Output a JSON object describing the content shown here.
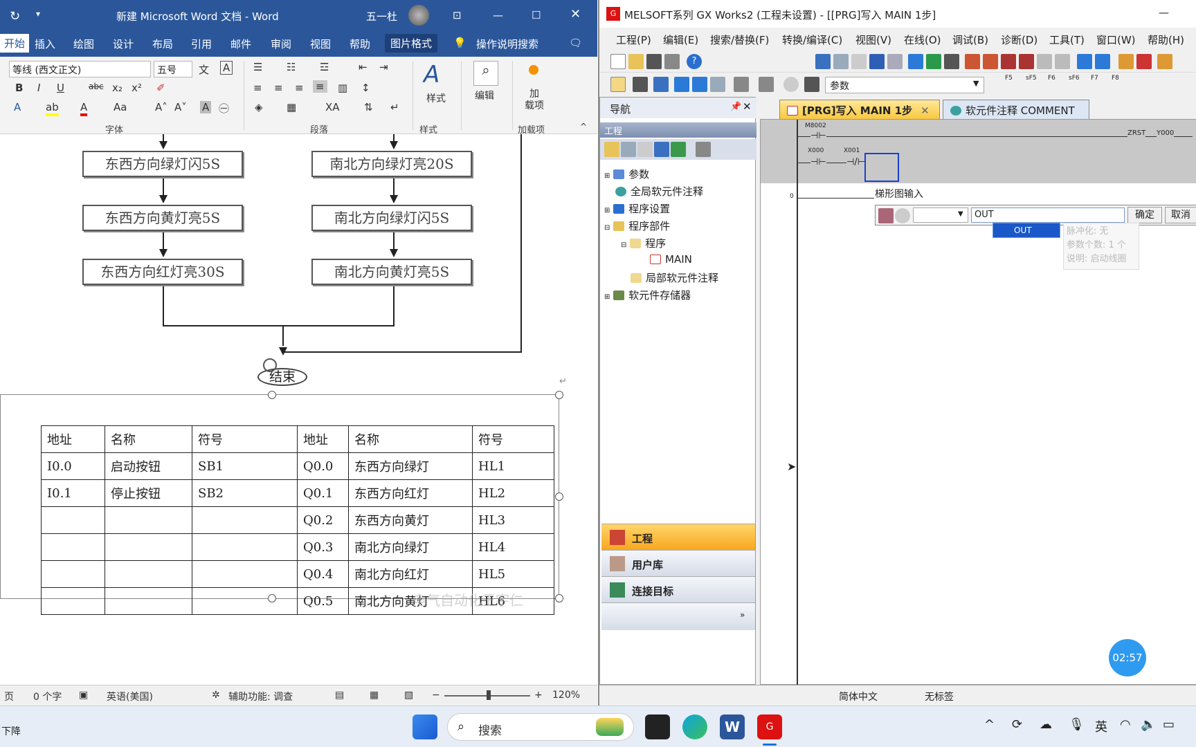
{
  "word": {
    "title": "新建 Microsoft Word 文档  -  Word",
    "user": "五一杜",
    "tabs": [
      "开始",
      "插入",
      "绘图",
      "设计",
      "布局",
      "引用",
      "邮件",
      "审阅",
      "视图",
      "帮助",
      "图片格式"
    ],
    "tell_me": "操作说明搜索",
    "font_name": "等线 (西文正文)",
    "font_size": "五号",
    "groups": {
      "font": "字体",
      "paragraph": "段落",
      "styles": "样式",
      "addins": "加载项"
    },
    "styles_btn": "样式",
    "edit_btn": "编辑",
    "addin_btn": "加\n载项",
    "flow_left": [
      "东西方向绿灯闪5S",
      "东西方向黄灯亮5S",
      "东西方向红灯亮30S"
    ],
    "flow_right": [
      "南北方向绿灯亮20S",
      "南北方向绿灯闪5S",
      "南北方向黄灯亮5S"
    ],
    "end_label": "结束",
    "watermark": "电气自动化王宇仁",
    "table": {
      "headers": [
        "地址",
        "名称",
        "符号",
        "地址",
        "名称",
        "符号"
      ],
      "rows": [
        [
          "I0.0",
          "启动按钮",
          "SB1",
          "Q0.0",
          "东西方向绿灯",
          "HL1"
        ],
        [
          "I0.1",
          "停止按钮",
          "SB2",
          "Q0.1",
          "东西方向红灯",
          "HL2"
        ],
        [
          "",
          "",
          "",
          "Q0.2",
          "东西方向黄灯",
          "HL3"
        ],
        [
          "",
          "",
          "",
          "Q0.3",
          "南北方向绿灯",
          "HL4"
        ],
        [
          "",
          "",
          "",
          "Q0.4",
          "南北方向红灯",
          "HL5"
        ],
        [
          "",
          "",
          "",
          "Q0.5",
          "南北方向黄灯",
          "HL6"
        ]
      ]
    },
    "status": {
      "page": "页",
      "words": "0 个字",
      "lang": "英语(美国)",
      "access": "辅助功能: 调查",
      "zoom": "120%"
    }
  },
  "gx": {
    "title": "MELSOFT系列 GX Works2 (工程未设置) - [[PRG]写入 MAIN 1步]",
    "menu": [
      "工程(P)",
      "编辑(E)",
      "搜索/替换(F)",
      "转换/编译(C)",
      "视图(V)",
      "在线(O)",
      "调试(B)",
      "诊断(D)",
      "工具(T)",
      "窗口(W)",
      "帮助(H)"
    ],
    "combo": "参数",
    "fkeys": [
      "F5",
      "sF5",
      "F6",
      "sF6",
      "F7",
      "F8"
    ],
    "nav_title": "导航",
    "proj_label": "工程",
    "tree": [
      "参数",
      "全局软元件注释",
      "程序设置",
      "程序部件",
      "程序",
      "MAIN",
      "局部软元件注释",
      "软元件存储器"
    ],
    "nav_buttons": [
      "工程",
      "用户库",
      "连接目标"
    ],
    "tabs": [
      "[PRG]写入 MAIN 1步",
      "软元件注释 COMMENT"
    ],
    "ladder": {
      "m8002": "M8002",
      "x000": "X000",
      "x001": "X001",
      "zrst": "ZRST",
      "y000": "Y000",
      "step": "0"
    },
    "dialog": {
      "title": "梯形图输入",
      "value": "OUT",
      "ok": "确定",
      "cancel": "取消",
      "suggest": "OUT",
      "tip1": "脉冲化: 无",
      "tip2": "参数个数: 1 个",
      "tip3": "说明: 启动线圈"
    },
    "status": {
      "lang": "简体中文",
      "label": "无标签"
    }
  },
  "timer": "02:57",
  "taskbar": {
    "search": "搜索",
    "left_text": "下降",
    "ime": "英"
  }
}
